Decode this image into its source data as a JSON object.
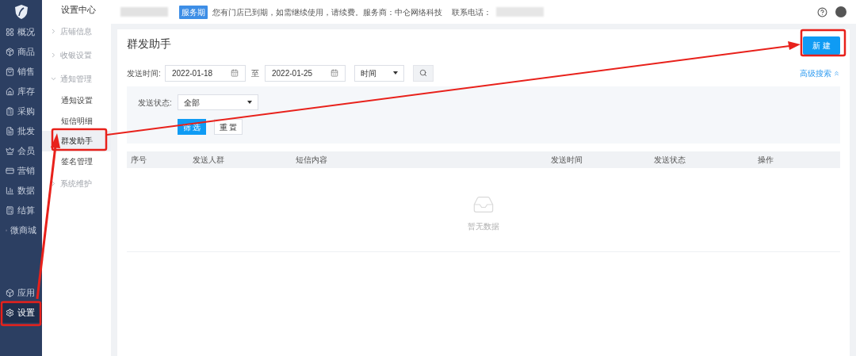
{
  "nav_items": [
    {
      "label": "概况",
      "selected": false
    },
    {
      "label": "商品",
      "selected": false
    },
    {
      "label": "销售",
      "selected": false
    },
    {
      "label": "库存",
      "selected": false
    },
    {
      "label": "采购",
      "selected": false
    },
    {
      "label": "批发",
      "selected": false
    },
    {
      "label": "会员",
      "selected": false
    },
    {
      "label": "营销",
      "selected": false
    },
    {
      "label": "数据",
      "selected": false
    },
    {
      "label": "结算",
      "selected": false
    },
    {
      "label": "微商城",
      "selected": false
    }
  ],
  "nav_bottom_items": [
    {
      "label": "应用",
      "selected": false
    },
    {
      "label": "设置",
      "selected": true
    }
  ],
  "sub_nav": {
    "title": "设置中心",
    "items": [
      {
        "label": "店铺信息",
        "expanded": false
      },
      {
        "label": "收银设置",
        "expanded": false
      },
      {
        "label": "通知管理",
        "expanded": true,
        "children": [
          {
            "label": "通知设置",
            "selected": false
          },
          {
            "label": "短信明细",
            "selected": false
          },
          {
            "label": "群发助手",
            "selected": true
          },
          {
            "label": "签名管理",
            "selected": false
          }
        ]
      },
      {
        "label": "系统维护",
        "expanded": false
      }
    ]
  },
  "top_bar": {
    "badge": "服务期",
    "notice": "您有门店已到期，如需继续使用，请续费。服务商：中仑网络科技",
    "phone_label": "联系电话："
  },
  "page": {
    "title": "群发助手",
    "new_button": "新 建",
    "filters": {
      "label": "发送时间:",
      "start_date": "2022-01-18",
      "separator": "至",
      "end_date": "2022-01-25",
      "time_select": "时间"
    },
    "advanced_search": {
      "label": "高级搜索",
      "expanded": true
    },
    "advanced_panel": {
      "status_label": "发送状态:",
      "status_select": "全部",
      "buttons": [
        {
          "label": "筛 选",
          "kind": "primary"
        },
        {
          "label": "重 置",
          "kind": "default"
        }
      ]
    },
    "table": {
      "columns": [
        "序号",
        "发送人群",
        "短信内容",
        "发送时间",
        "发送状态",
        "操作"
      ],
      "empty_text": "暂无数据"
    }
  }
}
